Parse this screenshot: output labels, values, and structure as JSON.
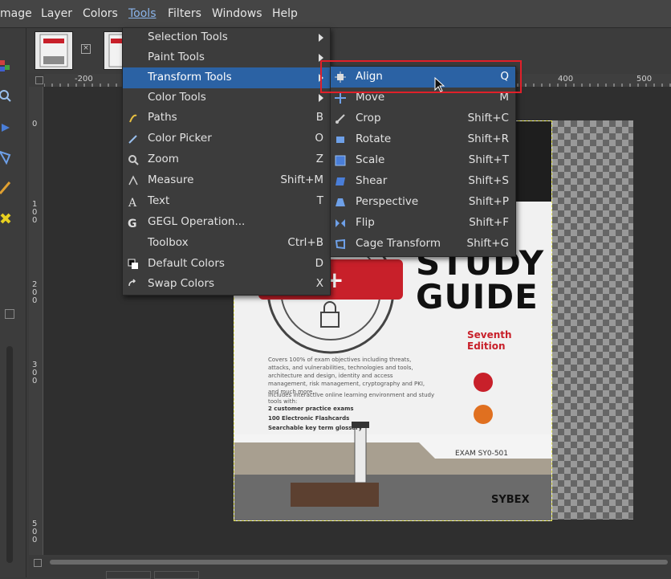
{
  "menubar": {
    "items": [
      {
        "label": "mage"
      },
      {
        "label": "Layer"
      },
      {
        "label": "Colors"
      },
      {
        "label": "Tools"
      },
      {
        "label": "Filters"
      },
      {
        "label": "Windows"
      },
      {
        "label": "Help"
      }
    ]
  },
  "rulers": {
    "h_labels": [
      "-200",
      "400",
      "500"
    ],
    "v_labels": [
      "0",
      "100",
      "200",
      "300",
      "500"
    ]
  },
  "tools_menu": {
    "items": [
      {
        "label": "Selection Tools",
        "shortcut": "",
        "icon": "none"
      },
      {
        "label": "Paint Tools",
        "shortcut": "",
        "icon": "none"
      },
      {
        "label": "Transform Tools",
        "shortcut": "",
        "icon": "none"
      },
      {
        "label": "Color Tools",
        "shortcut": "",
        "icon": "none"
      },
      {
        "label": "Paths",
        "shortcut": "B",
        "icon": "paths-icon"
      },
      {
        "label": "Color Picker",
        "shortcut": "O",
        "icon": "color-picker-icon"
      },
      {
        "label": "Zoom",
        "shortcut": "Z",
        "icon": "zoom-icon"
      },
      {
        "label": "Measure",
        "shortcut": "Shift+M",
        "icon": "measure-icon"
      },
      {
        "label": "Text",
        "shortcut": "T",
        "icon": "text-icon"
      },
      {
        "label": "GEGL Operation...",
        "shortcut": "",
        "icon": "gegl-icon"
      },
      {
        "label": "Toolbox",
        "shortcut": "Ctrl+B",
        "icon": "none"
      },
      {
        "label": "Default Colors",
        "shortcut": "D",
        "icon": "default-colors-icon"
      },
      {
        "label": "Swap Colors",
        "shortcut": "X",
        "icon": "swap-colors-icon"
      }
    ]
  },
  "transform_menu": {
    "items": [
      {
        "label": "Align",
        "shortcut": "Q",
        "icon": "align-icon"
      },
      {
        "label": "Move",
        "shortcut": "M",
        "icon": "move-icon"
      },
      {
        "label": "Crop",
        "shortcut": "Shift+C",
        "icon": "crop-icon"
      },
      {
        "label": "Rotate",
        "shortcut": "Shift+R",
        "icon": "rotate-icon"
      },
      {
        "label": "Scale",
        "shortcut": "Shift+T",
        "icon": "scale-icon"
      },
      {
        "label": "Shear",
        "shortcut": "Shift+S",
        "icon": "shear-icon"
      },
      {
        "label": "Perspective",
        "shortcut": "Shift+P",
        "icon": "perspective-icon"
      },
      {
        "label": "Flip",
        "shortcut": "Shift+F",
        "icon": "flip-icon"
      },
      {
        "label": "Cage Transform",
        "shortcut": "Shift+G",
        "icon": "cage-transform-icon"
      }
    ]
  },
  "image": {
    "badge": "urity+",
    "title_line1": "STUDY",
    "title_line2": "GUIDE",
    "edition": "Seventh Edition",
    "blurb": "Covers 100% of exam objectives including threats, attacks, and vulnerabilities, technologies and tools, architecture and design, identity and access management, risk management, cryptography and PKI, and much more...",
    "includes": "Includes interactive online learning environment and study tools with:",
    "bullets": [
      "2 customer practice exams",
      "100 Electronic Flashcards",
      "Searchable key term glossary"
    ],
    "exam": "EXAM SY0-501",
    "publisher": "SYBEX"
  },
  "colors": {
    "menu_bg": "#3c3c3c",
    "highlight": "#2b62a4",
    "annotation_red": "#e0202a",
    "cover_red": "#c8202a"
  }
}
